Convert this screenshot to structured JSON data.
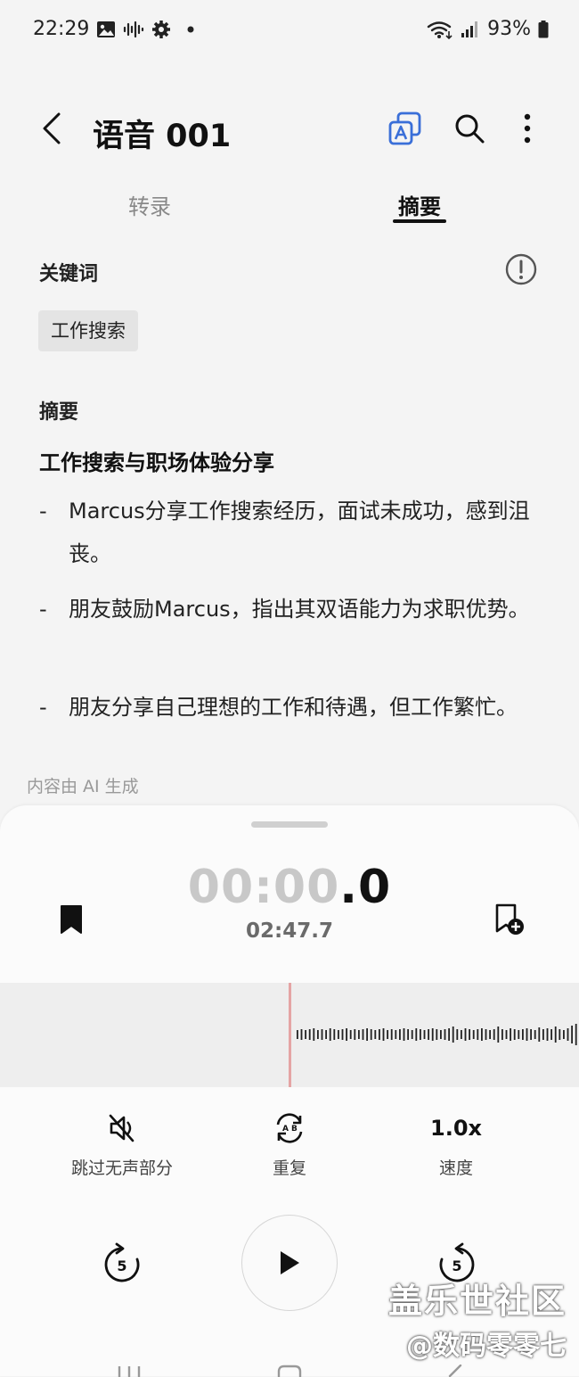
{
  "status": {
    "time": "22:29",
    "battery": "93%",
    "left_icons": [
      "image-icon",
      "voice-icon",
      "settings-icon",
      "dot-icon"
    ],
    "right_icons": [
      "wifi-icon",
      "signal-icon",
      "battery-icon"
    ]
  },
  "appbar": {
    "title": "语音 001",
    "actions": [
      "translate-icon",
      "search-icon",
      "more-icon"
    ]
  },
  "tabs": [
    {
      "label": "转录",
      "active": false
    },
    {
      "label": "摘要",
      "active": true
    }
  ],
  "keywords": {
    "label": "关键词",
    "items": [
      "工作搜索"
    ]
  },
  "summary": {
    "label": "摘要",
    "heading": "工作搜索与职场体验分享",
    "bullets": [
      {
        "dash": "-",
        "text": "Marcus分享工作搜索经历，面试未成功，感到沮丧。"
      },
      {
        "dash": "-",
        "text": "朋友鼓励Marcus，指出其双语能力为求职优势。"
      },
      {
        "dash": "-",
        "text": "朋友分享自己理想的工作和待遇，但工作繁忙。"
      }
    ],
    "ai_note": "内容由 AI 生成"
  },
  "player": {
    "elapsed_dim": "00:00",
    "elapsed_bright": ".0",
    "duration": "02:47.7",
    "controls": {
      "skip_silence": "跳过无声部分",
      "repeat": "重复",
      "speed_value": "1.0x",
      "speed_label": "速度"
    },
    "rewind_seconds": "5",
    "forward_seconds": "5",
    "accent_color": "#e5a4a4"
  },
  "watermark": {
    "line1": "盖乐世社区",
    "line2": "@数码零零七"
  }
}
